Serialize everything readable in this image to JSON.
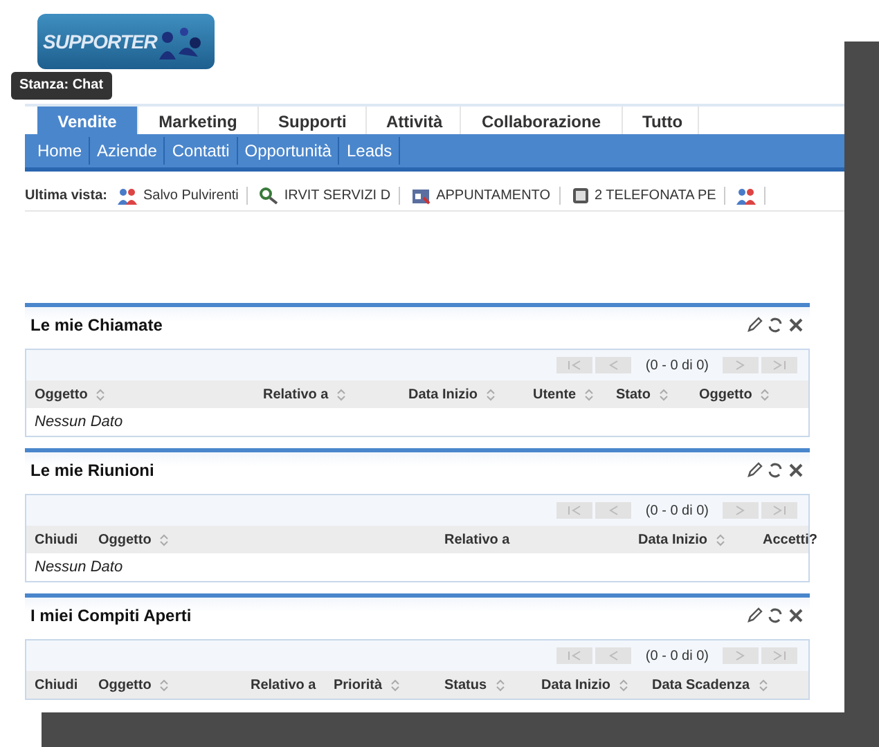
{
  "logo": {
    "text": "SUPPORTER"
  },
  "tooltip": {
    "text": "Stanza: Chat"
  },
  "tabs": [
    {
      "label": "Vendite",
      "selected": true
    },
    {
      "label": "Marketing",
      "selected": false
    },
    {
      "label": "Supporti",
      "selected": false
    },
    {
      "label": "Attività",
      "selected": false
    },
    {
      "label": "Collaborazione",
      "selected": false
    },
    {
      "label": "Tutto",
      "selected": false
    }
  ],
  "subnav": [
    "Home",
    "Aziende",
    "Contatti",
    "Opportunità",
    "Leads"
  ],
  "recent": {
    "label": "Ultima vista:",
    "items": [
      {
        "kind": "contact",
        "text": "Salvo Pulvirenti"
      },
      {
        "kind": "account",
        "text": "IRVIT SERVIZI D"
      },
      {
        "kind": "meeting",
        "text": "APPUNTAMENTO"
      },
      {
        "kind": "call",
        "text": "2 TELEFONATA PE"
      },
      {
        "kind": "contact"
      }
    ]
  },
  "dashlets": [
    {
      "title": "Le mie Chiamate",
      "pager": "(0 - 0 di 0)",
      "columns": [
        {
          "label": "Oggetto",
          "sortable": true
        },
        {
          "label": "Relativo a",
          "sortable": true
        },
        {
          "label": "Data Inizio",
          "sortable": true
        },
        {
          "label": "Utente",
          "sortable": true
        },
        {
          "label": "Stato",
          "sortable": true
        },
        {
          "label": "Oggetto",
          "sortable": true
        }
      ],
      "empty": "Nessun Dato"
    },
    {
      "title": "Le mie Riunioni",
      "pager": "(0 - 0 di 0)",
      "columns": [
        {
          "label": "Chiudi",
          "sortable": false
        },
        {
          "label": "Oggetto",
          "sortable": true
        },
        {
          "label": "Relativo a",
          "sortable": false
        },
        {
          "label": "Data Inizio",
          "sortable": true
        },
        {
          "label": "Accetti?",
          "sortable": false
        }
      ],
      "empty": "Nessun Dato"
    },
    {
      "title": "I miei Compiti Aperti",
      "pager": "(0 - 0 di 0)",
      "columns": [
        {
          "label": "Chiudi",
          "sortable": false
        },
        {
          "label": "Oggetto",
          "sortable": true
        },
        {
          "label": "Relativo a",
          "sortable": false
        },
        {
          "label": "Priorità",
          "sortable": true
        },
        {
          "label": "Status",
          "sortable": true
        },
        {
          "label": "Data Inizio",
          "sortable": true
        },
        {
          "label": "Data Scadenza",
          "sortable": true
        }
      ]
    }
  ]
}
